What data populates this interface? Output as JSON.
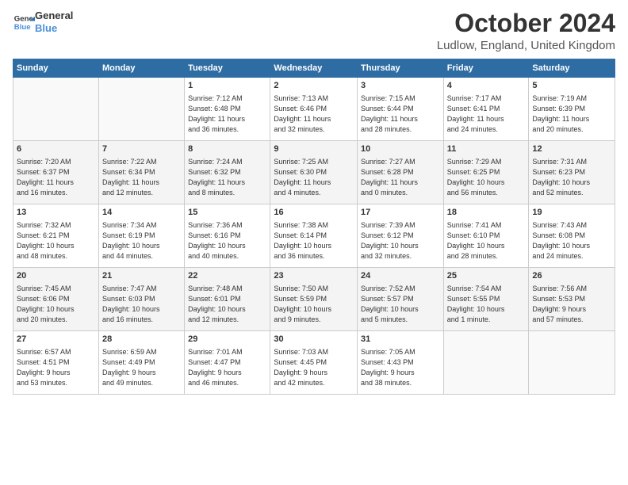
{
  "logo": {
    "line1": "General",
    "line2": "Blue"
  },
  "title": "October 2024",
  "location": "Ludlow, England, United Kingdom",
  "days_header": [
    "Sunday",
    "Monday",
    "Tuesday",
    "Wednesday",
    "Thursday",
    "Friday",
    "Saturday"
  ],
  "weeks": [
    [
      {
        "day": "",
        "info": ""
      },
      {
        "day": "",
        "info": ""
      },
      {
        "day": "1",
        "info": "Sunrise: 7:12 AM\nSunset: 6:48 PM\nDaylight: 11 hours\nand 36 minutes."
      },
      {
        "day": "2",
        "info": "Sunrise: 7:13 AM\nSunset: 6:46 PM\nDaylight: 11 hours\nand 32 minutes."
      },
      {
        "day": "3",
        "info": "Sunrise: 7:15 AM\nSunset: 6:44 PM\nDaylight: 11 hours\nand 28 minutes."
      },
      {
        "day": "4",
        "info": "Sunrise: 7:17 AM\nSunset: 6:41 PM\nDaylight: 11 hours\nand 24 minutes."
      },
      {
        "day": "5",
        "info": "Sunrise: 7:19 AM\nSunset: 6:39 PM\nDaylight: 11 hours\nand 20 minutes."
      }
    ],
    [
      {
        "day": "6",
        "info": "Sunrise: 7:20 AM\nSunset: 6:37 PM\nDaylight: 11 hours\nand 16 minutes."
      },
      {
        "day": "7",
        "info": "Sunrise: 7:22 AM\nSunset: 6:34 PM\nDaylight: 11 hours\nand 12 minutes."
      },
      {
        "day": "8",
        "info": "Sunrise: 7:24 AM\nSunset: 6:32 PM\nDaylight: 11 hours\nand 8 minutes."
      },
      {
        "day": "9",
        "info": "Sunrise: 7:25 AM\nSunset: 6:30 PM\nDaylight: 11 hours\nand 4 minutes."
      },
      {
        "day": "10",
        "info": "Sunrise: 7:27 AM\nSunset: 6:28 PM\nDaylight: 11 hours\nand 0 minutes."
      },
      {
        "day": "11",
        "info": "Sunrise: 7:29 AM\nSunset: 6:25 PM\nDaylight: 10 hours\nand 56 minutes."
      },
      {
        "day": "12",
        "info": "Sunrise: 7:31 AM\nSunset: 6:23 PM\nDaylight: 10 hours\nand 52 minutes."
      }
    ],
    [
      {
        "day": "13",
        "info": "Sunrise: 7:32 AM\nSunset: 6:21 PM\nDaylight: 10 hours\nand 48 minutes."
      },
      {
        "day": "14",
        "info": "Sunrise: 7:34 AM\nSunset: 6:19 PM\nDaylight: 10 hours\nand 44 minutes."
      },
      {
        "day": "15",
        "info": "Sunrise: 7:36 AM\nSunset: 6:16 PM\nDaylight: 10 hours\nand 40 minutes."
      },
      {
        "day": "16",
        "info": "Sunrise: 7:38 AM\nSunset: 6:14 PM\nDaylight: 10 hours\nand 36 minutes."
      },
      {
        "day": "17",
        "info": "Sunrise: 7:39 AM\nSunset: 6:12 PM\nDaylight: 10 hours\nand 32 minutes."
      },
      {
        "day": "18",
        "info": "Sunrise: 7:41 AM\nSunset: 6:10 PM\nDaylight: 10 hours\nand 28 minutes."
      },
      {
        "day": "19",
        "info": "Sunrise: 7:43 AM\nSunset: 6:08 PM\nDaylight: 10 hours\nand 24 minutes."
      }
    ],
    [
      {
        "day": "20",
        "info": "Sunrise: 7:45 AM\nSunset: 6:06 PM\nDaylight: 10 hours\nand 20 minutes."
      },
      {
        "day": "21",
        "info": "Sunrise: 7:47 AM\nSunset: 6:03 PM\nDaylight: 10 hours\nand 16 minutes."
      },
      {
        "day": "22",
        "info": "Sunrise: 7:48 AM\nSunset: 6:01 PM\nDaylight: 10 hours\nand 12 minutes."
      },
      {
        "day": "23",
        "info": "Sunrise: 7:50 AM\nSunset: 5:59 PM\nDaylight: 10 hours\nand 9 minutes."
      },
      {
        "day": "24",
        "info": "Sunrise: 7:52 AM\nSunset: 5:57 PM\nDaylight: 10 hours\nand 5 minutes."
      },
      {
        "day": "25",
        "info": "Sunrise: 7:54 AM\nSunset: 5:55 PM\nDaylight: 10 hours\nand 1 minute."
      },
      {
        "day": "26",
        "info": "Sunrise: 7:56 AM\nSunset: 5:53 PM\nDaylight: 9 hours\nand 57 minutes."
      }
    ],
    [
      {
        "day": "27",
        "info": "Sunrise: 6:57 AM\nSunset: 4:51 PM\nDaylight: 9 hours\nand 53 minutes."
      },
      {
        "day": "28",
        "info": "Sunrise: 6:59 AM\nSunset: 4:49 PM\nDaylight: 9 hours\nand 49 minutes."
      },
      {
        "day": "29",
        "info": "Sunrise: 7:01 AM\nSunset: 4:47 PM\nDaylight: 9 hours\nand 46 minutes."
      },
      {
        "day": "30",
        "info": "Sunrise: 7:03 AM\nSunset: 4:45 PM\nDaylight: 9 hours\nand 42 minutes."
      },
      {
        "day": "31",
        "info": "Sunrise: 7:05 AM\nSunset: 4:43 PM\nDaylight: 9 hours\nand 38 minutes."
      },
      {
        "day": "",
        "info": ""
      },
      {
        "day": "",
        "info": ""
      }
    ]
  ]
}
